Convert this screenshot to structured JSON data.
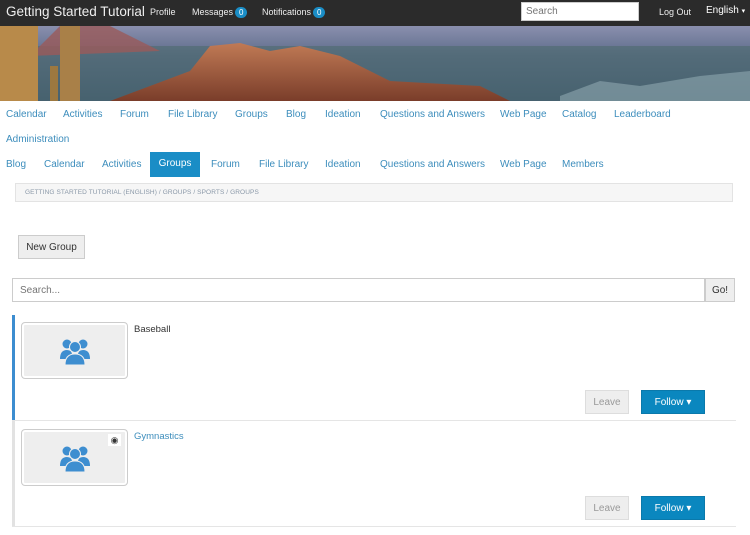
{
  "header": {
    "site_title": "Getting Started Tutorial",
    "profile": "Profile",
    "messages": {
      "label": "Messages",
      "count": "0"
    },
    "notifications": {
      "label": "Notifications",
      "count": "0"
    },
    "search_placeholder": "Search",
    "logout": "Log Out",
    "language": "English",
    "language_caret": "▾"
  },
  "primary_nav": [
    "Calendar",
    "Activities",
    "Forum",
    "File Library",
    "Groups",
    "Blog",
    "Ideation",
    "Questions and Answers",
    "Web Page",
    "Catalog",
    "Leaderboard",
    "Administration"
  ],
  "secondary_nav": {
    "items": [
      "Blog",
      "Calendar",
      "Activities",
      "Groups",
      "Forum",
      "File Library",
      "Ideation",
      "Questions and Answers",
      "Web Page",
      "Members"
    ],
    "active": "Groups"
  },
  "breadcrumb": "GETTING STARTED TUTORIAL (ENGLISH)  /  GROUPS  /  SPORTS  /  GROUPS",
  "new_group_label": "New Group",
  "search": {
    "placeholder": "Search...",
    "go_label": "Go!"
  },
  "groups": [
    {
      "name": "Baseball",
      "leave_label": "Leave",
      "follow_label": "Follow ▾",
      "selected": true,
      "private": false
    },
    {
      "name": "Gymnastics",
      "leave_label": "Leave",
      "follow_label": "Follow ▾",
      "selected": false,
      "private": true
    }
  ],
  "colors": {
    "accent": "#1a8dc6",
    "link": "#3c8dbc",
    "topbar": "#2b2b2b",
    "follow": "#0a87bf"
  }
}
